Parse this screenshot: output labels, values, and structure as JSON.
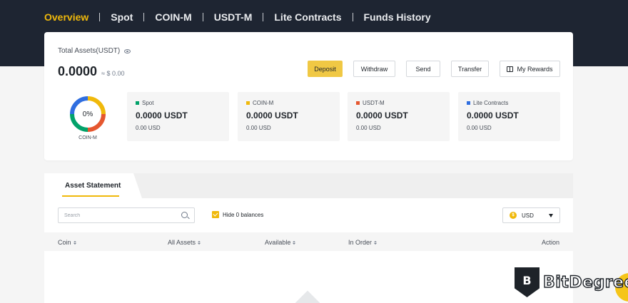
{
  "nav": {
    "items": [
      {
        "label": "Overview",
        "active": true
      },
      {
        "label": "Spot"
      },
      {
        "label": "COIN-M"
      },
      {
        "label": "USDT-M"
      },
      {
        "label": "Lite Contracts"
      },
      {
        "label": "Funds History"
      }
    ]
  },
  "summary": {
    "total_label": "Total Assets(USDT)",
    "total_value": "0.0000",
    "total_fiat": "≈ $ 0.00",
    "buttons": {
      "deposit": "Deposit",
      "withdraw": "Withdraw",
      "send": "Send",
      "transfer": "Transfer",
      "rewards": "My Rewards"
    },
    "donut": {
      "percent": "0%",
      "caption": "COIN-M"
    },
    "tiles": [
      {
        "label": "Spot",
        "value": "0.0000 USDT",
        "fiat": "0.00 USD",
        "color": "#02a26a"
      },
      {
        "label": "COIN-M",
        "value": "0.0000 USDT",
        "fiat": "0.00 USD",
        "color": "#f0b90b"
      },
      {
        "label": "USDT-M",
        "value": "0.0000 USDT",
        "fiat": "0.00 USD",
        "color": "#e5572f"
      },
      {
        "label": "Lite Contracts",
        "value": "0.0000 USDT",
        "fiat": "0.00 USD",
        "color": "#2f6ee0"
      }
    ]
  },
  "statement": {
    "tab_label": "Asset Statement",
    "search_placeholder": "Search",
    "hide_label": "Hide 0 balances",
    "hide_checked": true,
    "currency": "USD",
    "columns": [
      "Coin",
      "All Assets",
      "Available",
      "In Order",
      "Action"
    ]
  },
  "watermark": {
    "text": "BitDegree"
  },
  "colors": {
    "accent": "#f0b90b",
    "header_bg": "#1e2532"
  }
}
